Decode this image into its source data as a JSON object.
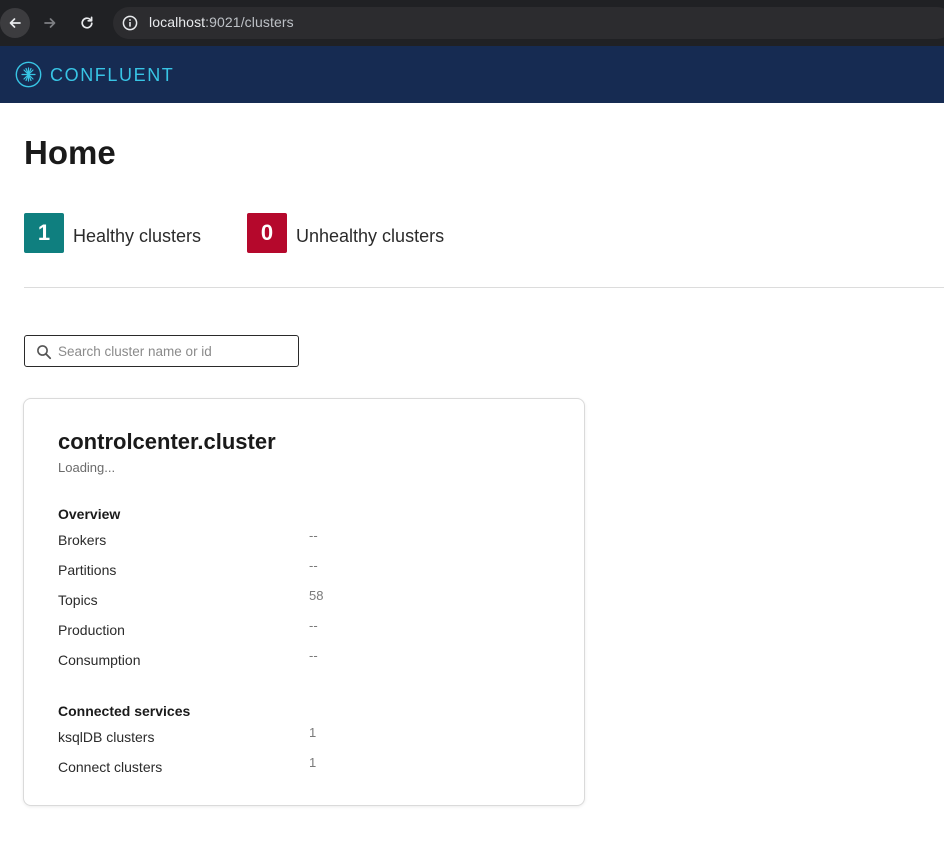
{
  "browser": {
    "url_host": "localhost",
    "url_rest": ":9021/clusters"
  },
  "app": {
    "brand": "CONFLUENT",
    "brand_color": "#38c5e5",
    "header_color": "#162b52"
  },
  "page": {
    "title": "Home"
  },
  "stats": {
    "healthy": {
      "count": "1",
      "label": "Healthy clusters",
      "color": "#0f7f7f"
    },
    "unhealthy": {
      "count": "0",
      "label": "Unhealthy clusters",
      "color": "#b5082c"
    }
  },
  "search": {
    "placeholder": "Search cluster name or id",
    "value": ""
  },
  "cluster_card": {
    "name": "controlcenter.cluster",
    "status": "Loading...",
    "overview_heading": "Overview",
    "overview": [
      {
        "label": "Brokers",
        "value": "--"
      },
      {
        "label": "Partitions",
        "value": "--"
      },
      {
        "label": "Topics",
        "value": "58"
      },
      {
        "label": "Production",
        "value": "--"
      },
      {
        "label": "Consumption",
        "value": "--"
      }
    ],
    "services_heading": "Connected services",
    "services": [
      {
        "label": "ksqlDB clusters",
        "value": "1"
      },
      {
        "label": "Connect clusters",
        "value": "1"
      }
    ]
  }
}
